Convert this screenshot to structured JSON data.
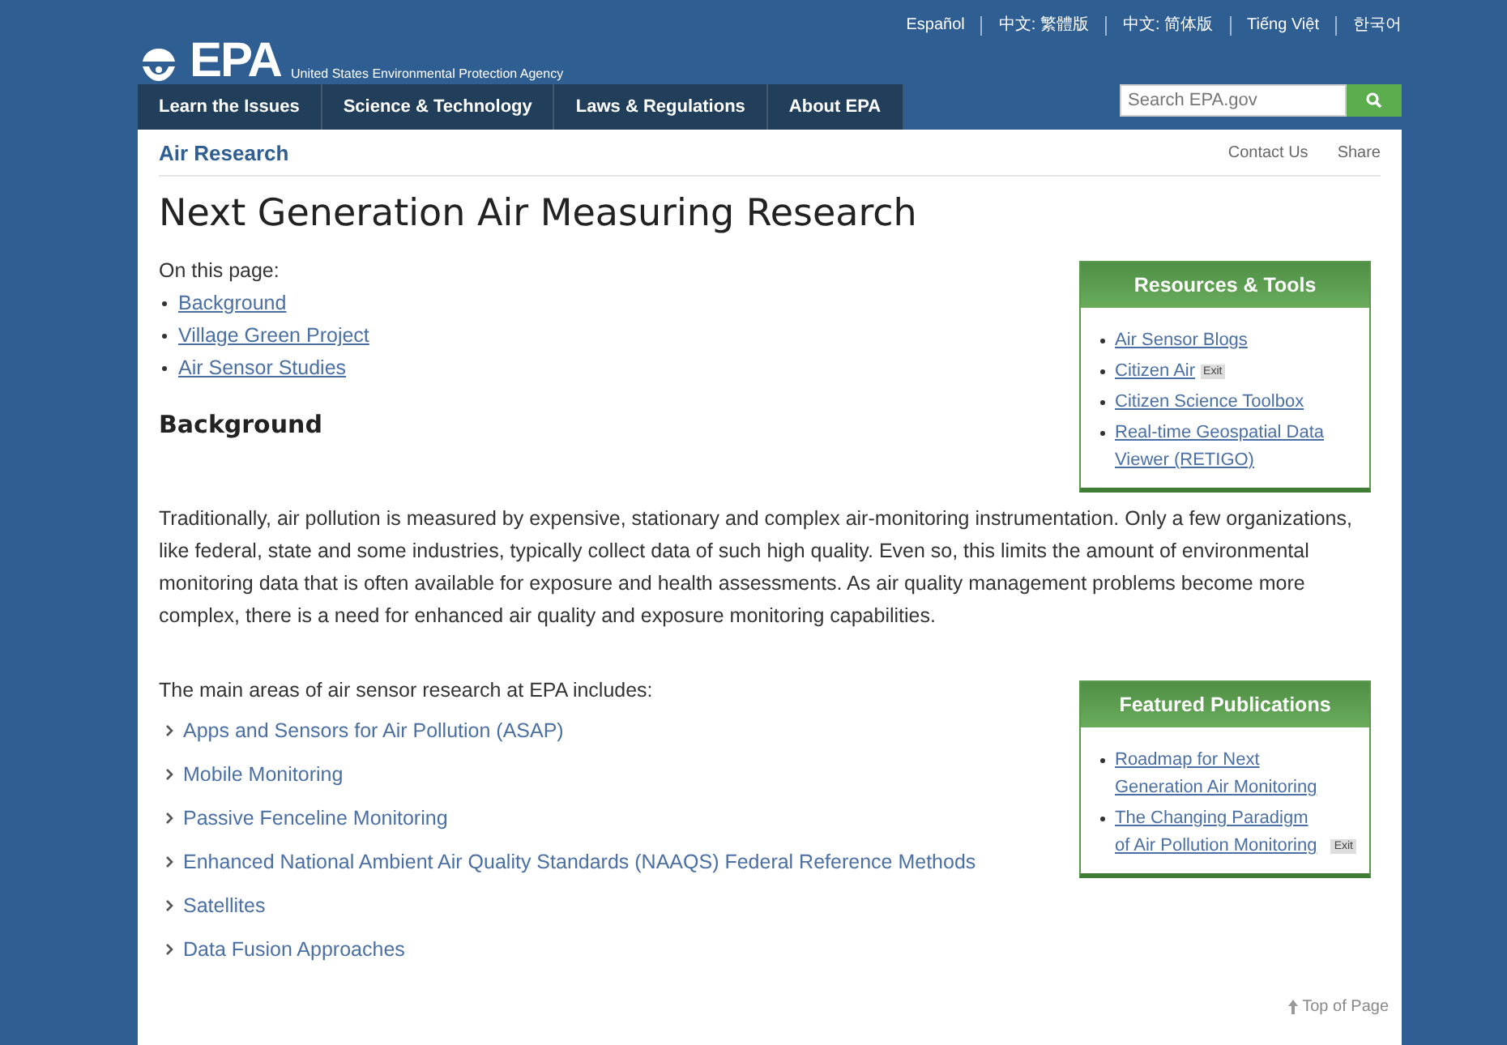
{
  "header": {
    "logo": "EPA",
    "agency": "United States Environmental Protection Agency",
    "languages": [
      "Español",
      "中文: 繁體版",
      "中文: 简体版",
      "Tiếng Việt",
      "한국어"
    ]
  },
  "nav": {
    "items": [
      {
        "label": "Learn the Issues"
      },
      {
        "label": "Science & Technology"
      },
      {
        "label": "Laws & Regulations"
      },
      {
        "label": "About EPA"
      }
    ],
    "search": {
      "placeholder": "Search EPA.gov"
    }
  },
  "section_bar": {
    "title": "Air Research",
    "links": [
      "Contact Us",
      "Share"
    ]
  },
  "title": "Next Generation Air Measuring Research",
  "on_this_page": {
    "label": "On this page:",
    "links": [
      "Background",
      "Village Green Project",
      "Air Sensor Studies"
    ]
  },
  "sideboxes": [
    {
      "title": "Resources & Tools",
      "links": [
        {
          "text": "Air Sensor Blogs"
        },
        {
          "text": "Citizen Air",
          "badge": "Exit"
        },
        {
          "text": "Citizen Science Toolbox"
        },
        {
          "text": "Real-time Geospatial Data Viewer (RETIGO)"
        }
      ]
    },
    {
      "title": "Featured Publications",
      "links": [
        {
          "text": "Roadmap for Next Generation Air Monitoring"
        },
        {
          "text": "The Changing Paradigm of Air Pollution Monitoring",
          "badge": "Exit"
        }
      ]
    }
  ],
  "background": {
    "heading": "Background",
    "text": "Traditionally, air pollution is measured by expensive, stationary and complex air-monitoring instrumentation. Only a few organizations, like federal, state and some industries, typically collect data of such high quality. Even so, this limits the amount of environmental monitoring data that is often available for exposure and health assessments. As air quality management problems become more complex, there is a need for enhanced air quality and exposure monitoring capabilities."
  },
  "research_areas": {
    "intro": "The main areas of air sensor research at EPA includes:",
    "items": [
      "Apps and Sensors for Air Pollution (ASAP)",
      "Mobile Monitoring",
      "Passive Fenceline Monitoring",
      "Enhanced National Ambient Air Quality Standards (NAAQS) Federal Reference Methods",
      "Satellites",
      "Data Fusion Approaches"
    ]
  },
  "footer": {
    "top_link": "Top of Page"
  }
}
